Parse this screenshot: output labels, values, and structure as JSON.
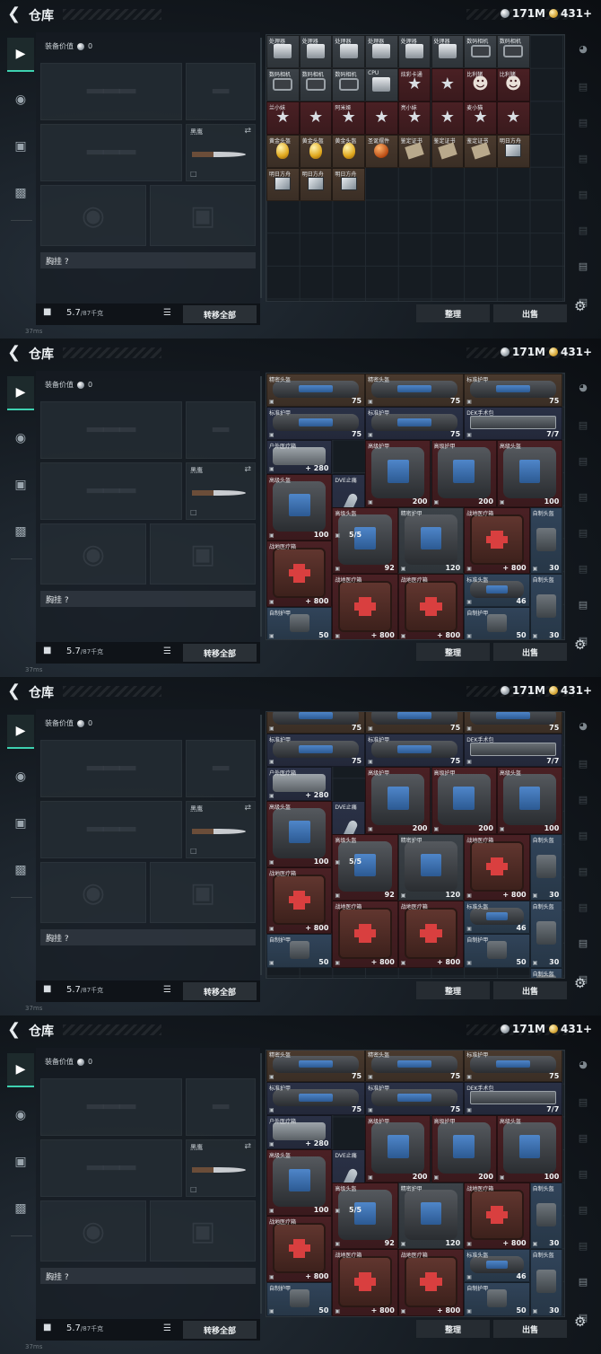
{
  "title": "仓库",
  "currency": {
    "silver": "171M",
    "gold": "431+"
  },
  "gear_panel": {
    "value_label": "装备价值",
    "value": "0",
    "knife_label": "黑鹰",
    "chest_rig_label": "胸挂 ?",
    "weight": "5.7",
    "weight_max": "/87千克",
    "transfer_all": "转移全部"
  },
  "actions": {
    "sort": "整理",
    "sell": "出售"
  },
  "status_ping": "37ms",
  "left_nav": [
    "weapon-icon",
    "armor-icon",
    "backpack-icon",
    "chest-icon"
  ],
  "right_nav": [
    "helmet-icon",
    "tab1",
    "tab2",
    "tab3",
    "tab4",
    "tab5",
    "tab6",
    "add-tab"
  ],
  "screens": [
    {
      "name": "screen-1",
      "items": [
        {
          "n": "处理器",
          "c": "",
          "bg": "gray",
          "k": "cpu"
        },
        {
          "n": "处理器",
          "c": "",
          "bg": "gray",
          "k": "cpu"
        },
        {
          "n": "处理器",
          "c": "",
          "bg": "gray",
          "k": "cpu"
        },
        {
          "n": "处理器",
          "c": "",
          "bg": "gray",
          "k": "cpu"
        },
        {
          "n": "处理器",
          "c": "",
          "bg": "gray",
          "k": "cpu"
        },
        {
          "n": "处理器",
          "c": "",
          "bg": "gray",
          "k": "cpu"
        },
        {
          "n": "数码相机",
          "c": "",
          "bg": "gray",
          "k": "cam"
        },
        {
          "n": "数码相机",
          "c": "",
          "bg": "gray",
          "k": "cam"
        },
        {
          "n": "数码相机",
          "c": "",
          "bg": "gray",
          "k": "cam"
        },
        {
          "n": "数码相机",
          "c": "",
          "bg": "gray",
          "k": "cam"
        },
        {
          "n": "数码相机",
          "c": "",
          "bg": "gray",
          "k": "cam"
        },
        {
          "n": "CPU",
          "c": "",
          "bg": "gray",
          "k": "cpu"
        },
        {
          "n": "炫彩卡通",
          "c": "",
          "bg": "red",
          "k": "toy"
        },
        {
          "n": "",
          "c": "",
          "bg": "red",
          "k": "toy"
        },
        {
          "n": "比利猪",
          "c": "",
          "bg": "red",
          "k": "doll"
        },
        {
          "n": "比利猪",
          "c": "",
          "bg": "red",
          "k": "doll"
        },
        {
          "n": "兰小妹",
          "c": "",
          "bg": "red",
          "k": "toy"
        },
        {
          "n": "",
          "c": "",
          "bg": "red",
          "k": "toy"
        },
        {
          "n": "阿米娅",
          "c": "",
          "bg": "red",
          "k": "toy"
        },
        {
          "n": "",
          "c": "",
          "bg": "red",
          "k": "toy"
        },
        {
          "n": "亮小妹",
          "c": "",
          "bg": "red",
          "k": "toy"
        },
        {
          "n": "",
          "c": "",
          "bg": "red",
          "k": "toy"
        },
        {
          "n": "麦小猫",
          "c": "",
          "bg": "red",
          "k": "toy"
        },
        {
          "n": "",
          "c": "",
          "bg": "red",
          "k": "toy"
        },
        {
          "n": "黄金头盔",
          "c": "",
          "bg": "brown",
          "k": "egg"
        },
        {
          "n": "黄金头盔",
          "c": "",
          "bg": "brown",
          "k": "egg"
        },
        {
          "n": "黄金头盔",
          "c": "",
          "bg": "brown",
          "k": "egg"
        },
        {
          "n": "圣诞摆件",
          "c": "",
          "bg": "brown",
          "k": "orn"
        },
        {
          "n": "鉴定证书",
          "c": "",
          "bg": "brown",
          "k": "doc"
        },
        {
          "n": "鉴定证书",
          "c": "",
          "bg": "brown",
          "k": "doc"
        },
        {
          "n": "鉴定证书",
          "c": "",
          "bg": "brown",
          "k": "doc"
        },
        {
          "n": "明日方舟",
          "c": "",
          "bg": "brown",
          "k": "card"
        },
        {
          "n": "明日方舟",
          "c": "",
          "bg": "brown",
          "k": "card"
        },
        {
          "n": "明日方舟",
          "c": "",
          "bg": "brown",
          "k": "card"
        },
        {
          "n": "明日方舟",
          "c": "",
          "bg": "brown",
          "k": "card"
        }
      ]
    }
  ],
  "gear_items": [
    {
      "n": "精密头盔",
      "c": "75",
      "bg": "brown"
    },
    {
      "n": "精密头盔",
      "c": "75",
      "bg": "brown"
    },
    {
      "n": "标准护甲",
      "c": "75",
      "bg": "brown"
    },
    {
      "n": "标准护甲",
      "c": "75",
      "bg": "navy"
    },
    {
      "n": "标准护甲",
      "c": "75",
      "bg": "navy"
    },
    {
      "n": "DEK手术包",
      "c": "7/7",
      "bg": "navy"
    },
    {
      "n": "户外医疗箱",
      "c": "+ 280",
      "bg": "navy"
    },
    {
      "n": "高级护甲",
      "c": "200",
      "bg": "red"
    },
    {
      "n": "高级护甲",
      "c": "200",
      "bg": "red"
    },
    {
      "n": "高级头盔",
      "c": "100",
      "bg": "red"
    },
    {
      "n": "高级头盔",
      "c": "100",
      "bg": "red"
    },
    {
      "n": "DVE止痛",
      "c": "5/5",
      "bg": "navy"
    },
    {
      "n": "高级头盔",
      "c": "92",
      "bg": "red"
    },
    {
      "n": "精密护甲",
      "c": "120",
      "bg": "gray"
    },
    {
      "n": "战地医疗箱",
      "c": "+ 800",
      "bg": "red"
    },
    {
      "n": "自制头盔",
      "c": "30",
      "bg": "blue"
    },
    {
      "n": "战地医疗箱",
      "c": "+ 800",
      "bg": "red"
    },
    {
      "n": "战地医疗箱",
      "c": "+ 800",
      "bg": "red"
    },
    {
      "n": "战地医疗箱",
      "c": "+ 800",
      "bg": "red"
    },
    {
      "n": "标准头盔",
      "c": "46",
      "bg": "blue"
    },
    {
      "n": "自制头盔",
      "c": "30",
      "bg": "blue"
    },
    {
      "n": "自制护甲",
      "c": "50",
      "bg": "blue"
    },
    {
      "n": "自制护甲",
      "c": "50",
      "bg": "blue"
    },
    {
      "n": "自制头盔",
      "c": "30",
      "bg": "blue"
    }
  ]
}
